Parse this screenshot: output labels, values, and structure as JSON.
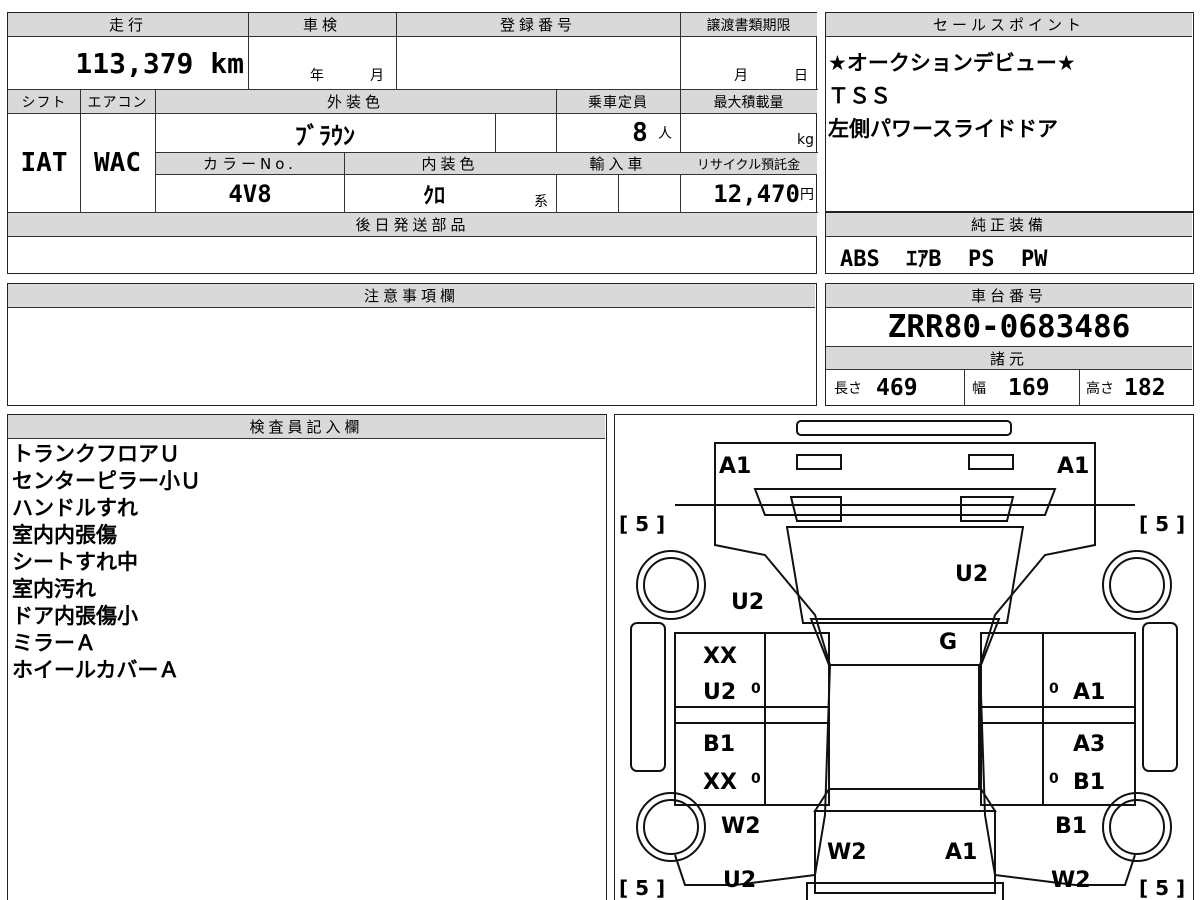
{
  "spec": {
    "mileage_label": "走行",
    "mileage_value": "113,379",
    "mileage_unit": "km",
    "inspection_label": "車検",
    "inspection_year": "年",
    "inspection_month": "月",
    "reg_label": "登録番号",
    "doc_limit_label": "譲渡書類期限",
    "doc_limit_month": "月",
    "doc_limit_day": "日",
    "shift_label": "シフト",
    "shift_value": "IAT",
    "ac_label": "エアコン",
    "ac_value": "WAC",
    "ext_color_label": "外装色",
    "ext_color_value": "ﾌﾞﾗｳﾝ",
    "capacity_label": "乗車定員",
    "capacity_value": "8",
    "capacity_unit": "人",
    "max_load_label": "最大積載量",
    "max_load_unit": "kg",
    "color_no_label": "カラーNo.",
    "color_no_value": "4V8",
    "int_color_label": "内装色",
    "int_color_value": "ｸﾛ",
    "int_color_suffix": "系",
    "import_label": "輸入車",
    "recycle_label": "リサイクル預託金",
    "recycle_value": "12,470",
    "recycle_unit": "円",
    "later_parts_label": "後日発送部品"
  },
  "sales": {
    "label": "セールスポイント",
    "lines": [
      "★オークションデビュー★",
      "ＴＳＳ",
      "左側パワースライドドア"
    ]
  },
  "equipment": {
    "label": "純正装備",
    "value": "ABS  ｴｱB  PS  PW"
  },
  "notes": {
    "label": "注意事項欄"
  },
  "chassis": {
    "label": "車台番号",
    "value": "ZRR80-0683486",
    "dims_label": "諸元",
    "length_label": "長さ",
    "length_value": "469",
    "width_label": "幅",
    "width_value": "169",
    "height_label": "高さ",
    "height_value": "182"
  },
  "inspector": {
    "label": "検査員記入欄",
    "lines": [
      "トランクフロアＵ",
      "センターピラー小Ｕ",
      "ハンドルすれ",
      "室内内張傷",
      "シートすれ中",
      "室内汚れ",
      "ドア内張傷小",
      "ミラーＡ",
      "ホイールカバーＡ"
    ]
  },
  "diagram": {
    "marks": [
      "A1",
      "A1",
      "U2",
      "U2",
      "G",
      "XX",
      "U2",
      "A1",
      "B1",
      "XX",
      "A3",
      "B1",
      "W2",
      "B1",
      "W2",
      "A1",
      "U2",
      "W2"
    ],
    "tire_labels": [
      "[ 5 ]",
      "[ 5 ]",
      "[ 5 ]",
      "[ 5 ]"
    ],
    "tiny": [
      "0",
      "0",
      "0",
      "0"
    ]
  }
}
